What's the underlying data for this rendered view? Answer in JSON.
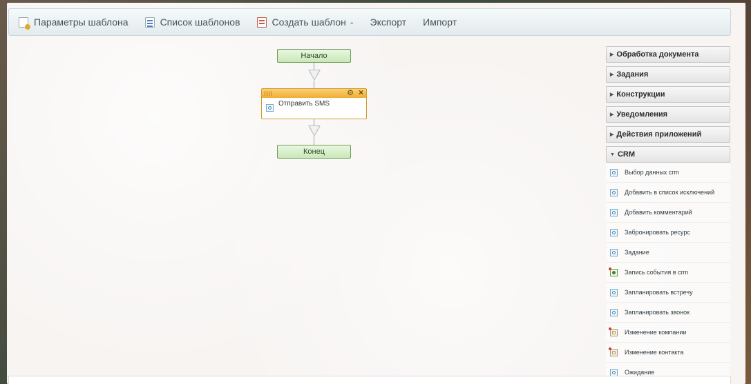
{
  "toolbar": {
    "params_label": "Параметры шаблона",
    "list_label": "Список шаблонов",
    "create_label": "Создать шаблон",
    "create_caret": "-",
    "export_label": "Экспорт",
    "import_label": "Импорт"
  },
  "workflow": {
    "start_label": "Начало",
    "activity_label": "Отправить SMS",
    "end_label": "Конец"
  },
  "panel": {
    "sections": [
      {
        "label": "Обработка документа",
        "expanded": false
      },
      {
        "label": "Задания",
        "expanded": false
      },
      {
        "label": "Конструкции",
        "expanded": false
      },
      {
        "label": "Уведомления",
        "expanded": false
      },
      {
        "label": "Действия приложений",
        "expanded": false
      },
      {
        "label": "CRM",
        "expanded": true
      }
    ],
    "crm_items": [
      {
        "label": "Выбор данных crm",
        "icon": "activity-icon"
      },
      {
        "label": "Добавить в список исключений",
        "icon": "activity-icon"
      },
      {
        "label": "Добавить комментарий",
        "icon": "activity-icon"
      },
      {
        "label": "Забронировать ресурс",
        "icon": "activity-icon"
      },
      {
        "label": "Задание",
        "icon": "activity-icon"
      },
      {
        "label": "Запись события в crm",
        "icon": "event-icon"
      },
      {
        "label": "Запланировать встречу",
        "icon": "activity-icon"
      },
      {
        "label": "Запланировать звонок",
        "icon": "activity-icon"
      },
      {
        "label": "Изменение компании",
        "icon": "company-icon"
      },
      {
        "label": "Изменение контакта",
        "icon": "contact-icon"
      },
      {
        "label": "Ожидание",
        "icon": "activity-icon"
      }
    ]
  }
}
